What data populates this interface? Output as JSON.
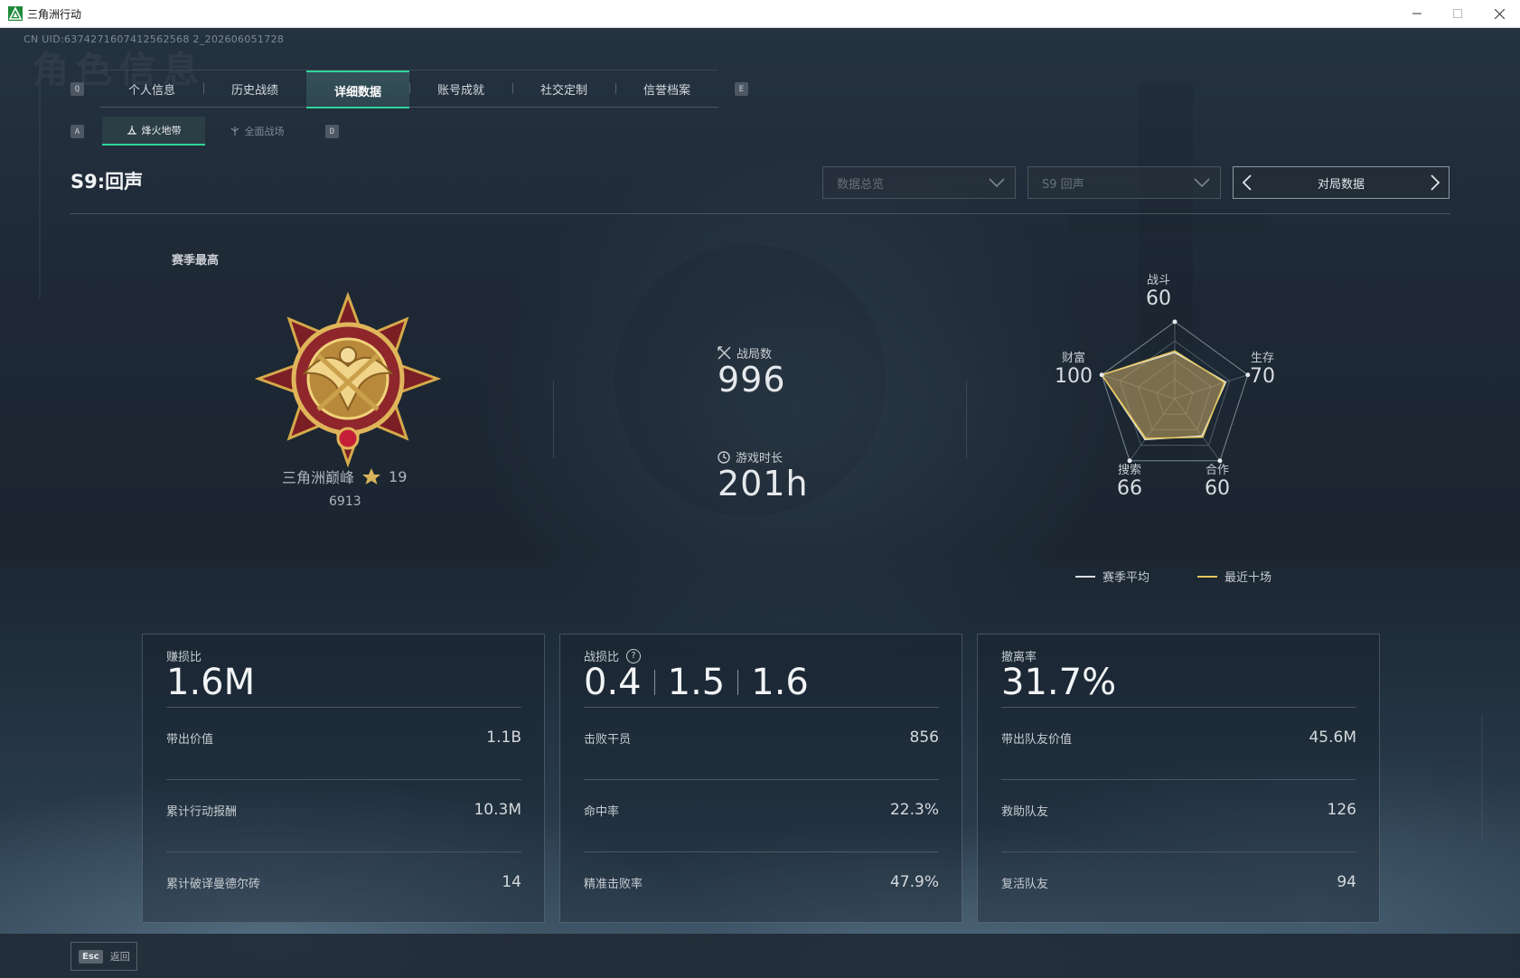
{
  "window": {
    "title": "三角洲行动"
  },
  "uid": "CN UID:6374271607412562568 2_202606051728",
  "ghost_title": "角色信息",
  "keys": {
    "left_tab": "Q",
    "right_tab": "E",
    "left_sub": "A",
    "right_sub": "D"
  },
  "tabs": [
    {
      "label": "个人信息"
    },
    {
      "label": "历史战绩"
    },
    {
      "label": "详细数据",
      "active": true
    },
    {
      "label": "账号成就"
    },
    {
      "label": "社交定制"
    },
    {
      "label": "信誉档案"
    }
  ],
  "subtabs": [
    {
      "label": "烽火地带",
      "active": true
    },
    {
      "label": "全面战场"
    }
  ],
  "season_title": "S9:回声",
  "filters": {
    "data_type": "数据总览",
    "season": "S9 回声",
    "pager_label": "对局数据"
  },
  "season_best": {
    "label": "赛季最高",
    "rank_name": "三角洲巅峰",
    "rank_stars": "19",
    "rank_points": "6913"
  },
  "summary": {
    "matches_label": "战局数",
    "matches_value": "996",
    "playtime_label": "游戏时长",
    "playtime_value": "201h"
  },
  "radar": {
    "axes": [
      {
        "name": "战斗",
        "value": "60"
      },
      {
        "name": "生存",
        "value": "70"
      },
      {
        "name": "合作",
        "value": "60"
      },
      {
        "name": "搜索",
        "value": "66"
      },
      {
        "name": "财富",
        "value": "100"
      }
    ],
    "legend": [
      {
        "label": "赛季平均",
        "color": "#d9dde1"
      },
      {
        "label": "最近十场",
        "color": "#e6c75a"
      }
    ],
    "season_avg": [
      60,
      70,
      60,
      66,
      100
    ],
    "recent_ten": [
      62,
      68,
      62,
      64,
      100
    ]
  },
  "cards": [
    {
      "title": "赚损比",
      "big": "1.6M",
      "rows": [
        {
          "label": "带出价值",
          "value": "1.1B"
        },
        {
          "label": "累计行动报酬",
          "value": "10.3M"
        },
        {
          "label": "累计破译曼德尔砖",
          "value": "14"
        }
      ]
    },
    {
      "title": "战损比",
      "help": "?",
      "big_values": [
        "0.4",
        "1.5",
        "1.6"
      ],
      "rows": [
        {
          "label": "击败干员",
          "value": "856"
        },
        {
          "label": "命中率",
          "value": "22.3%"
        },
        {
          "label": "精准击败率",
          "value": "47.9%"
        }
      ]
    },
    {
      "title": "撤离率",
      "big": "31.7%",
      "rows": [
        {
          "label": "带出队友价值",
          "value": "45.6M"
        },
        {
          "label": "救助队友",
          "value": "126"
        },
        {
          "label": "复活队友",
          "value": "94"
        }
      ]
    }
  ],
  "footer": {
    "esc_key": "Esc",
    "back_label": "返回"
  },
  "colors": {
    "accent": "#2fd597",
    "radar_fill": "#c9a85a"
  }
}
